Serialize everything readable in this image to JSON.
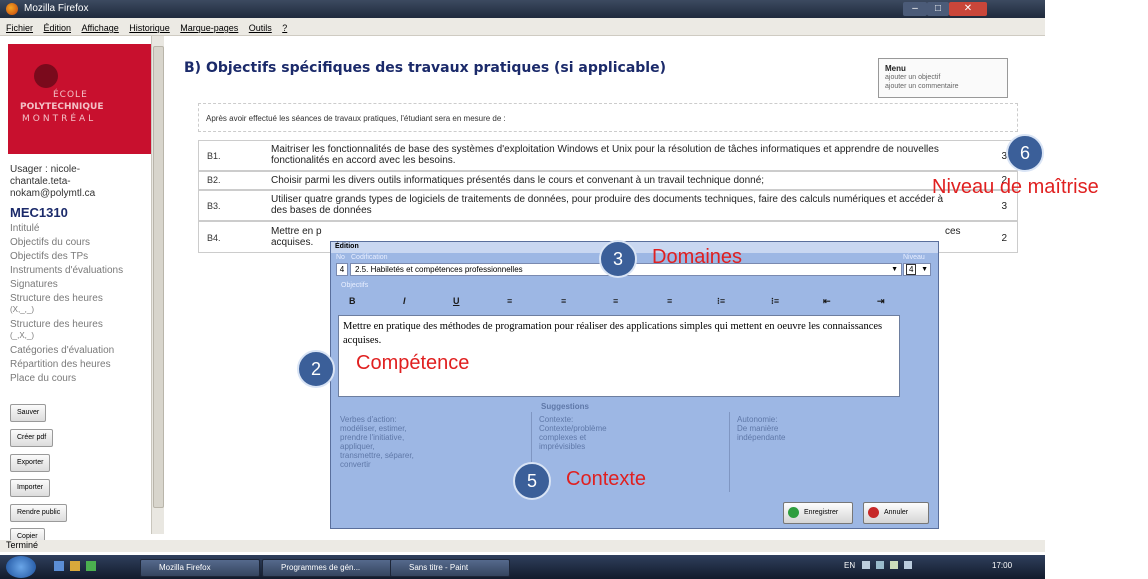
{
  "window": {
    "title": "Mozilla Firefox"
  },
  "menubar": [
    "Fichier",
    "Édition",
    "Affichage",
    "Historique",
    "Marque-pages",
    "Outils",
    "?"
  ],
  "sidebar": {
    "logo_line1": "ÉCOLE",
    "logo_line2": "POLYTECHNIQUE",
    "logo_line3": "MONTRÉAL",
    "user": [
      "Usager : nicole-",
      "chantale.teta-",
      "nokam@polymtl.ca"
    ],
    "course": "MEC1310",
    "links": [
      "Intitulé",
      "Objectifs du cours",
      "Objectifs des TPs",
      "Instruments d'évaluations",
      "Signatures",
      "Structure des heures",
      "(X,_,_)",
      "Structure des heures",
      "(_,X,_)",
      "Catégories d'évaluation",
      "Répartition des heures",
      "Place du cours"
    ],
    "buttons": [
      "Sauver",
      "Créer pdf",
      "Exporter",
      "Importer",
      "Rendre public",
      "Copier"
    ]
  },
  "main": {
    "title": "B) Objectifs spécifiques des travaux pratiques (si applicable)",
    "menu": {
      "title": "Menu",
      "items": [
        "ajouter un objectif",
        "ajouter un commentaire"
      ]
    },
    "intro": "Après avoir effectué les séances de travaux pratiques, l'étudiant sera en mesure de :",
    "objectives": [
      {
        "code": "B1.",
        "text": "Maitriser les fonctionnalités de base des systèmes d'exploitation Windows et Unix pour la résolution de tâches informatiques et apprendre de nouvelles fonctionalités en accord avec les besoins.",
        "level": "3"
      },
      {
        "code": "B2.",
        "text": "Choisir parmi les divers outils informatiques présentés dans le cours et convenant à un travail technique donné;",
        "level": "2"
      },
      {
        "code": "B3.",
        "text": "Utiliser quatre grands types de logiciels de traitements de données, pour produire des documents techniques, faire des calculs numériques et accéder à des bases de données",
        "level": "3"
      },
      {
        "code": "B4.",
        "text": "Mettre en p",
        "text_end": "ces",
        "text_line2": "acquises.",
        "level": "2"
      }
    ]
  },
  "dialog": {
    "title": "Édition",
    "no_label": "No",
    "codification_label": "Codification",
    "niveau_label": "Niveau",
    "no_value": "4",
    "codification_value": "2.5. Habiletés et compétences professionnelles",
    "niveau_value": "4",
    "objectif_label": "Objectifs",
    "format_buttons": [
      "B",
      "I",
      "U",
      "≡",
      "≡",
      "≡",
      "≡",
      "⁝≡",
      "⁝≡",
      "⇤",
      "⇥"
    ],
    "text": "Mettre en pratique des méthodes de programation pour réaliser des applications simples qui mettent en oeuvre les connaissances acquises.",
    "suggestions_title": "Suggestions",
    "suggestions": [
      "Verbes d'action:\nmodéliser, estimer,\nprendre l'initiative,\nappliquer,\ntransmettre, séparer,\nconvertir",
      "Contexte:\nContexte/problème\ncomplexes et\nimprévisibles",
      "Autonomie:\nDe manière\nindépendante"
    ],
    "save": "Enregistrer",
    "cancel": "Annuler"
  },
  "annotations": {
    "c6": "6",
    "l6": "Niveau de maîtrise",
    "c3": "3",
    "l3": "Domaines",
    "c2": "2",
    "l2": "Compétence",
    "c5": "5",
    "l5": "Contexte"
  },
  "status": "Terminé",
  "taskbar": {
    "items": [
      "Mozilla Firefox",
      "Programmes de gén...",
      "Sans titre - Paint"
    ],
    "lang": "EN",
    "clock": "17:00"
  },
  "colors": {
    "accent": "#1b2a6a",
    "annotation": "#e02020",
    "dialog": "#9db7e4",
    "logo": "#c8102e"
  }
}
